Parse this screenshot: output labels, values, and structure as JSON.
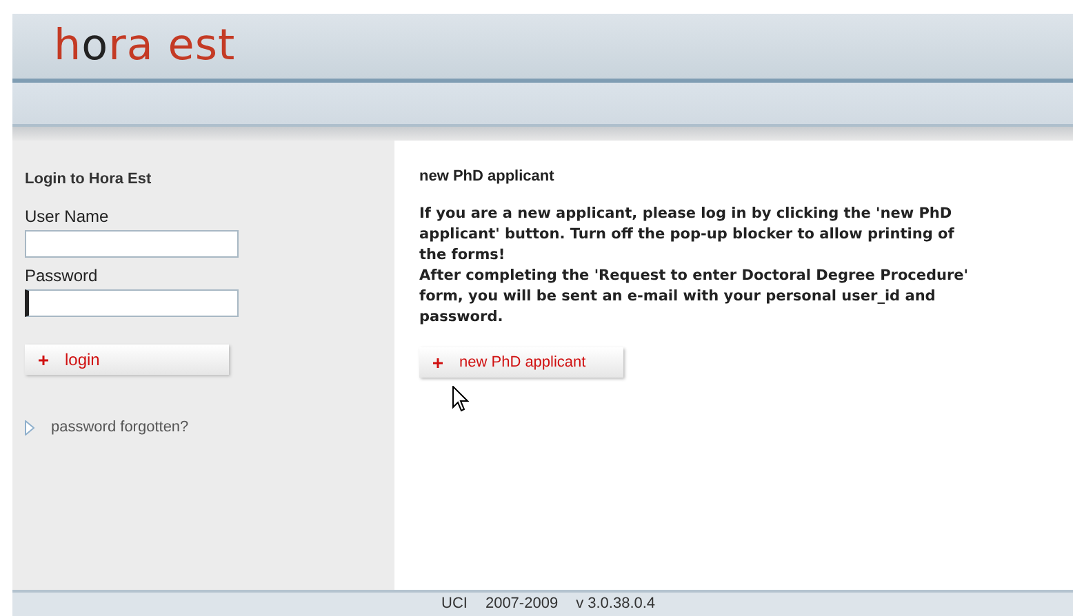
{
  "header": {
    "logo": "hora est"
  },
  "login": {
    "title": "Login to Hora Est",
    "fields": [
      {
        "label": "User Name",
        "focused": false
      },
      {
        "label": "Password",
        "focused": true
      }
    ],
    "button": "login",
    "forgot_link": "password forgotten?"
  },
  "info": {
    "title": "new PhD applicant",
    "paragraphs": [
      "If you are a new applicant, please log in by clicking the 'new PhD applicant' button. Turn off the pop-up blocker to allow printing of the forms!",
      "After completing the 'Request to enter Doctoral Degree Procedure' form, you will be sent an e-mail with your personal user_id and password."
    ],
    "button": "new PhD applicant"
  },
  "footer": [
    "UCI",
    "2007-2009",
    "v 3.0.38.0.4"
  ]
}
